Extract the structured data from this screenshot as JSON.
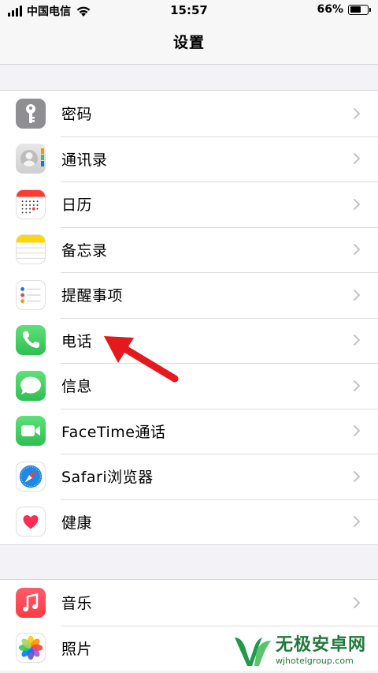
{
  "status_bar": {
    "carrier": "中国电信",
    "time": "15:57",
    "battery_percent": "66%",
    "battery_level": 0.66
  },
  "nav": {
    "title": "设置"
  },
  "groups": [
    {
      "items": [
        {
          "label": "密码",
          "icon": "key-icon",
          "color": "#8e8e93"
        },
        {
          "label": "通讯录",
          "icon": "contacts-icon",
          "color": "#d6d6d6"
        },
        {
          "label": "日历",
          "icon": "calendar-icon",
          "color": "#ffffff"
        },
        {
          "label": "备忘录",
          "icon": "notes-icon",
          "color": "#ffd60a"
        },
        {
          "label": "提醒事项",
          "icon": "reminders-icon",
          "color": "#ffffff"
        },
        {
          "label": "电话",
          "icon": "phone-icon",
          "color": "#34c759"
        },
        {
          "label": "信息",
          "icon": "messages-icon",
          "color": "#34c759"
        },
        {
          "label": "FaceTime通话",
          "icon": "facetime-icon",
          "color": "#34c759"
        },
        {
          "label": "Safari浏览器",
          "icon": "safari-icon",
          "color": "#1e88e5"
        },
        {
          "label": "健康",
          "icon": "health-icon",
          "color": "#ff2d55"
        }
      ]
    },
    {
      "items": [
        {
          "label": "音乐",
          "icon": "music-icon",
          "color": "#fc3c44"
        },
        {
          "label": "照片",
          "icon": "photos-icon",
          "color": "#ffffff"
        }
      ]
    }
  ],
  "watermark": {
    "title": "无极安卓网",
    "url": "wjhotelgroup.com"
  }
}
